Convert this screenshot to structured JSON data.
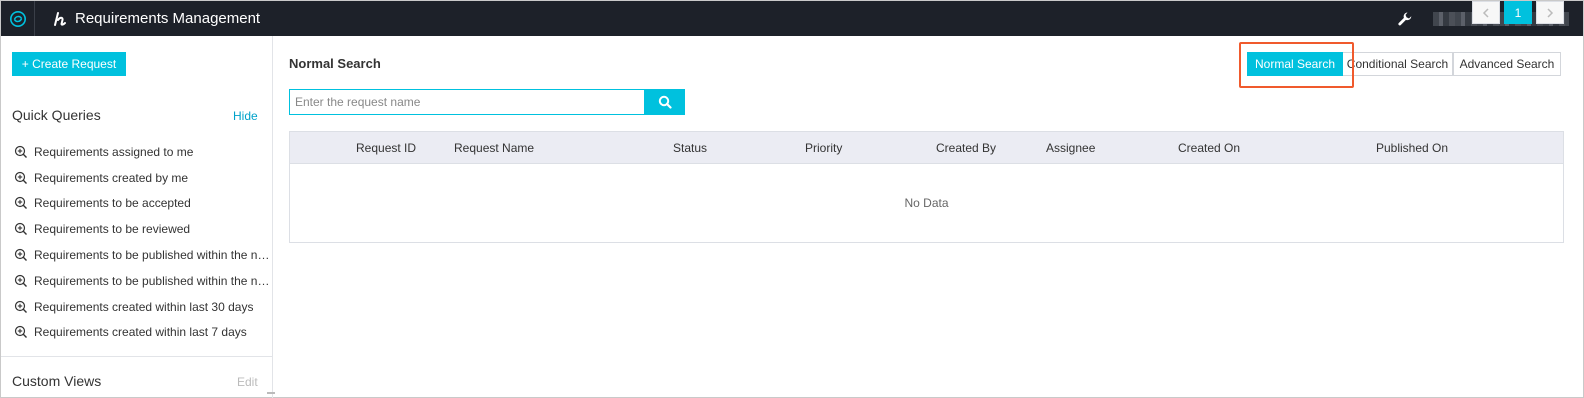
{
  "app": {
    "title": "Requirements Management"
  },
  "sidebar": {
    "create_label": "+ Create Request",
    "quick_queries_title": "Quick Queries",
    "hide_label": "Hide",
    "quick_queries": [
      "Requirements assigned to me",
      "Requirements created by me",
      "Requirements to be accepted",
      "Requirements to be reviewed",
      "Requirements to be published within the next...",
      "Requirements to be published within the next...",
      "Requirements created within last 30 days",
      "Requirements created within last 7 days"
    ],
    "custom_views_title": "Custom Views",
    "edit_label": "Edit"
  },
  "main": {
    "title": "Normal Search",
    "modes": [
      "Normal Search",
      "Conditional Search",
      "Advanced Search"
    ],
    "active_mode": "Normal Search",
    "search_placeholder": "Enter the request name",
    "table": {
      "columns": [
        "Request ID",
        "Request Name",
        "Status",
        "Priority",
        "Created By",
        "Assignee",
        "Created On",
        "Published On"
      ],
      "empty_text": "No Data"
    },
    "pagination": {
      "current_page": "1"
    }
  },
  "colors": {
    "accent": "#00c1de",
    "topbar": "#1d2129",
    "highlight": "#f05a2d"
  }
}
